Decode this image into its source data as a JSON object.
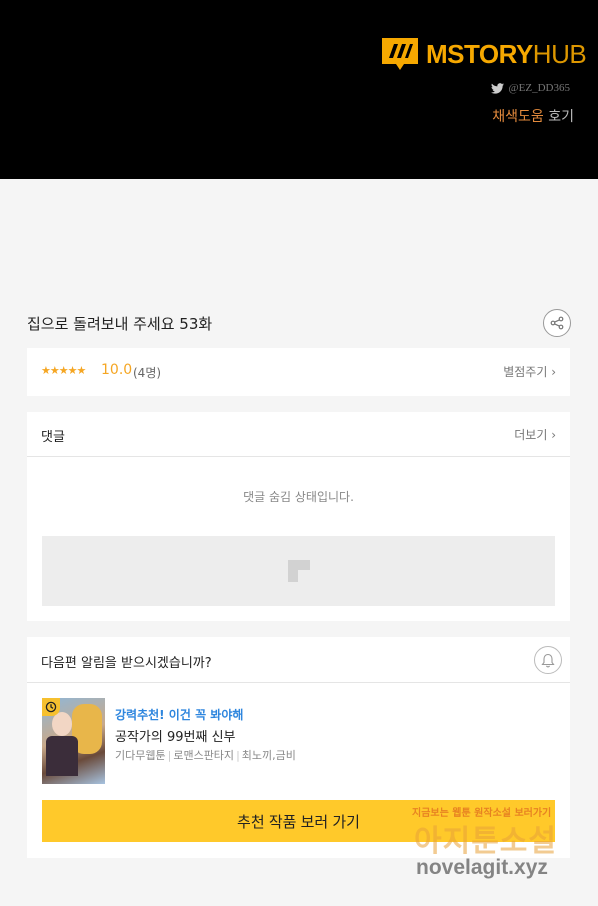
{
  "header": {
    "logo_text_main": "MSTORY",
    "logo_text_hub": "HUB",
    "twitter_handle": "@EZ_DD365",
    "credit_accent": "채색도움",
    "credit_rest": " 호기",
    "colors": {
      "background": "#000000",
      "brand": "#f6a800",
      "credit_accent": "#e38a3c"
    }
  },
  "episode": {
    "title": "집으로 돌려보내 주세요 53화",
    "share_icon": "share-icon"
  },
  "rating": {
    "stars": "★★★★★",
    "score": "10.0",
    "count": "(4명)",
    "rate_link": "별점주기 ›",
    "star_color": "#f5a623"
  },
  "comments": {
    "title": "댓글",
    "more_link": "더보기 ›",
    "hidden_message": "댓글 숨김 상태입니다."
  },
  "notify": {
    "question": "다음편 알림을 받으시겠습니까?",
    "bell_icon": "bell-icon"
  },
  "recommendation": {
    "promo_label": "강력추천! 이건 꼭 봐야해",
    "title": "공작가의 99번째 신부",
    "meta": [
      "기다무웹툰",
      "로맨스판타지",
      "최노끼,금비"
    ],
    "cta_label": "추천 작품 보러 가기",
    "cta_color": "#ffc92a",
    "promo_color": "#2e86de"
  },
  "watermark": {
    "line1": "지금보는 웹툰 원작소설 보러가기",
    "line2": "아지툰소설",
    "line3": "novelagit.xyz"
  }
}
